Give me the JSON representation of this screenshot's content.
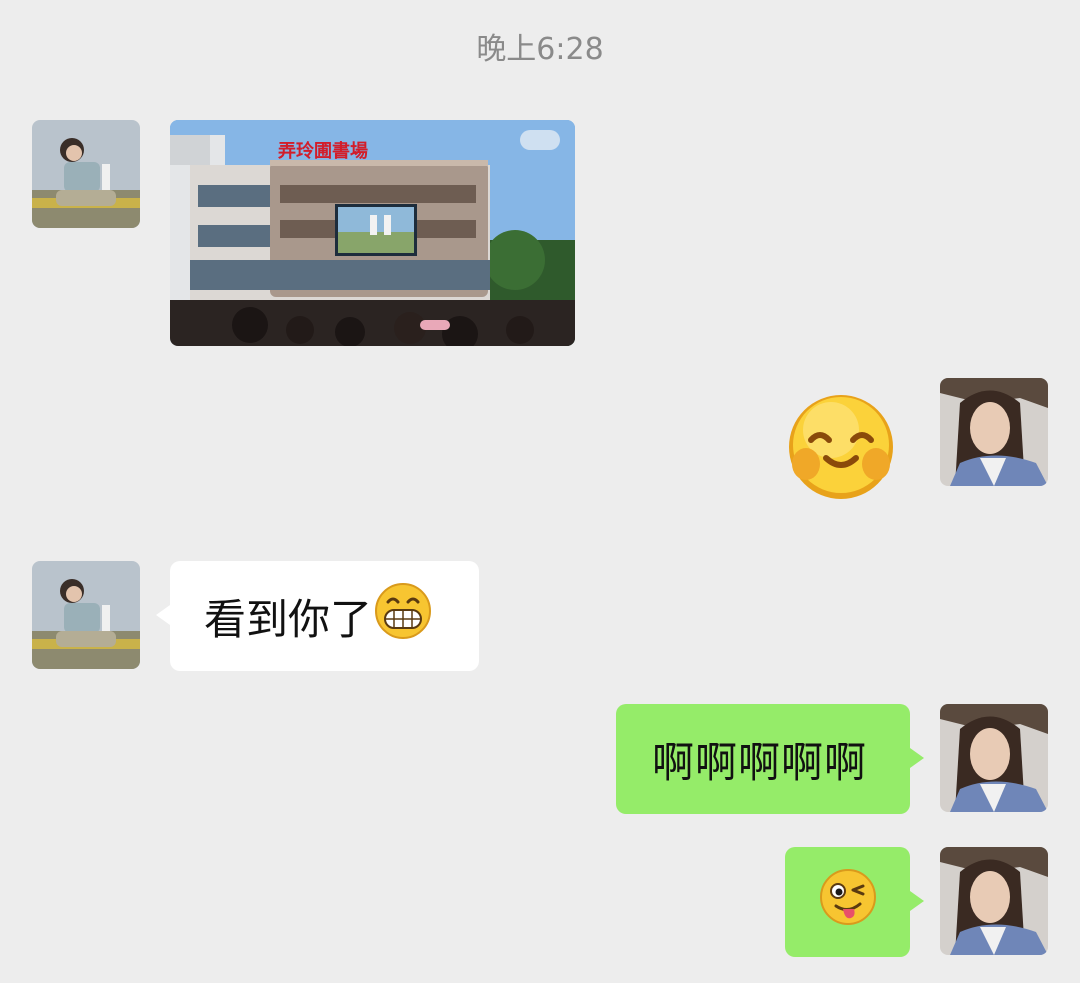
{
  "chat": {
    "timestamp": "晚上6:28",
    "messages": [
      {
        "side": "left",
        "type": "image",
        "description_icon": "photo-icon",
        "sign_text": "弄玲圃書場"
      },
      {
        "side": "right",
        "type": "sticker",
        "icon": "blushing-smile-sticker-icon"
      },
      {
        "side": "left",
        "type": "text",
        "text": "看到你了",
        "emoji": "grinning-teeth-emoji-icon"
      },
      {
        "side": "right",
        "type": "text",
        "text": "啊啊啊啊啊"
      },
      {
        "side": "right",
        "type": "emoji",
        "emoji": "winking-tongue-emoji-icon"
      }
    ]
  },
  "colors": {
    "background": "#ededed",
    "incoming_bubble": "#ffffff",
    "outgoing_bubble": "#95ec69",
    "timestamp": "#8a8a8a"
  }
}
